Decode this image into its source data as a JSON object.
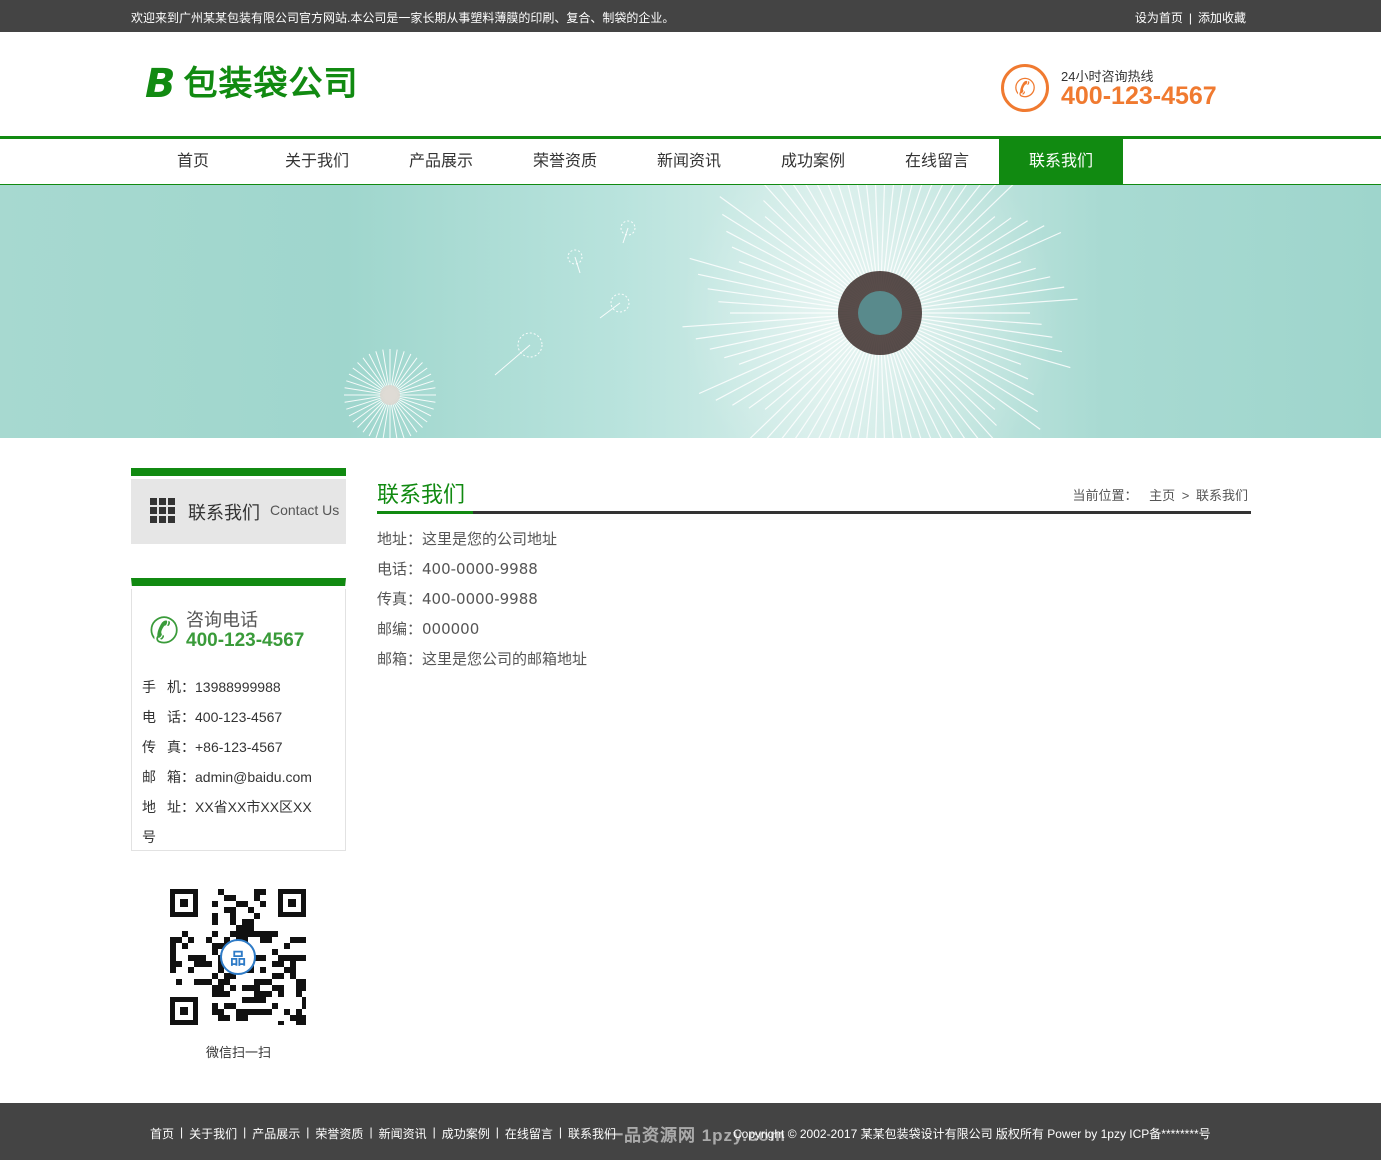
{
  "topbar": {
    "welcome": "欢迎来到广州某某包装有限公司官方网站.本公司是一家长期从事塑料薄膜的印刷、复合、制袋的企业。",
    "set_home": "设为首页",
    "sep": "|",
    "add_fav": "添加收藏"
  },
  "header": {
    "logo_mark": "B",
    "logo_text": "包装袋公司",
    "hotline_label": "24小时咨询热线",
    "hotline_number": "400-123-4567",
    "accent_color": "#f07a30",
    "brand_color": "#118a11"
  },
  "nav": {
    "items": [
      "首页",
      "关于我们",
      "产品展示",
      "荣誉资质",
      "新闻资讯",
      "成功案例",
      "在线留言",
      "联系我们"
    ],
    "active_index": 7
  },
  "sidebar": {
    "section_title": "联系我们",
    "section_en": "Contact Us",
    "tel_title": "咨询电话",
    "tel_number": "400-123-4567",
    "rows": [
      {
        "k1": "手",
        "k2": "机",
        "v": "：13988999988"
      },
      {
        "k1": "电",
        "k2": "话",
        "v": "：400-123-4567"
      },
      {
        "k1": "传",
        "k2": "真",
        "v": "：+86-123-4567"
      },
      {
        "k1": "邮",
        "k2": "箱",
        "v": "：admin@baidu.com"
      },
      {
        "k1": "地",
        "k2": "址",
        "v": "：XX省XX市XX区XX"
      },
      {
        "k1": "号",
        "k2": "",
        "v": ""
      }
    ],
    "qr_caption": "微信扫一扫"
  },
  "main": {
    "title": "联系我们",
    "crumb_label": "当前位置：",
    "crumb_home": "主页",
    "crumb_sep": ">",
    "crumb_current": "联系我们",
    "lines": [
      "地址：这里是您的公司地址",
      "电话：400-0000-9988",
      "传真：400-0000-9988",
      "邮编：000000",
      "邮箱：这里是您公司的邮箱地址"
    ]
  },
  "footer": {
    "links": [
      "首页",
      "关于我们",
      "产品展示",
      "荣誉资质",
      "新闻资讯",
      "成功案例",
      "在线留言",
      "联系我们"
    ],
    "copyright": "Copyright © 2002-2017 某某包装袋设计有限公司 版权所有 Power by 1pzy ICP备********号",
    "watermark": "一品资源网 1pzy.com"
  }
}
